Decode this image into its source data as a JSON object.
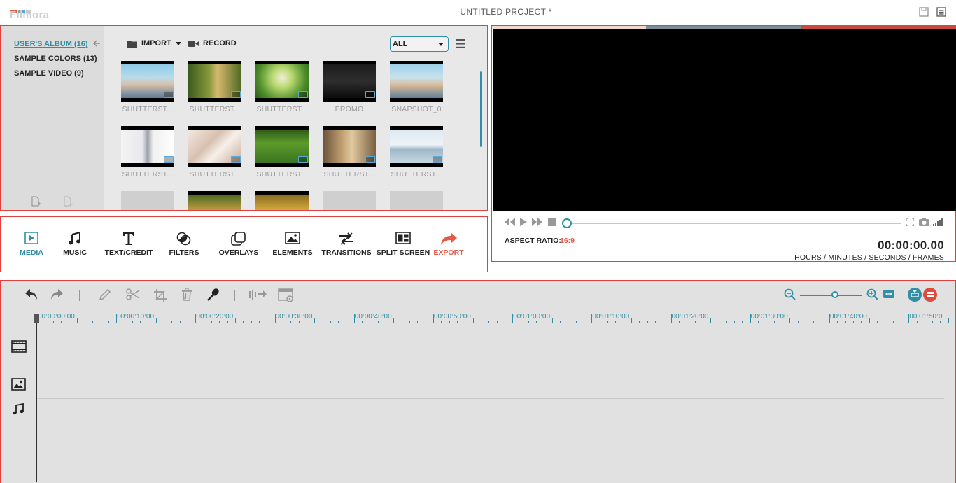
{
  "app": {
    "logo_text": "Filmora",
    "project_title": "UNTITLED PROJECT *"
  },
  "colors": {
    "accent": "#2f8fa6",
    "export": "#e35a46",
    "panel_border": "#e04040"
  },
  "library": {
    "albums": [
      {
        "label": "USER'S ALBUM (16)",
        "active": true
      },
      {
        "label": "SAMPLE COLORS (13)",
        "active": false
      },
      {
        "label": "SAMPLE VIDEO (9)",
        "active": false
      }
    ],
    "import_label": "IMPORT",
    "record_label": "RECORD",
    "filter_value": "ALL",
    "items": [
      {
        "label": "SHUTTERST..."
      },
      {
        "label": "SHUTTERST..."
      },
      {
        "label": "SHUTTERST..."
      },
      {
        "label": "PROMO"
      },
      {
        "label": "SNAPSHOT_0"
      },
      {
        "label": "SHUTTERST..."
      },
      {
        "label": "SHUTTERST..."
      },
      {
        "label": "SHUTTERST..."
      },
      {
        "label": "SHUTTERST..."
      },
      {
        "label": "SHUTTERST..."
      }
    ]
  },
  "tools": [
    {
      "label": "MEDIA",
      "icon": "media-icon"
    },
    {
      "label": "MUSIC",
      "icon": "music-icon"
    },
    {
      "label": "TEXT/CREDIT",
      "icon": "text-icon"
    },
    {
      "label": "FILTERS",
      "icon": "filters-icon"
    },
    {
      "label": "OVERLAYS",
      "icon": "overlays-icon"
    },
    {
      "label": "ELEMENTS",
      "icon": "elements-icon"
    },
    {
      "label": "TRANSITIONS",
      "icon": "transitions-icon"
    },
    {
      "label": "SPLIT SCREEN",
      "icon": "split-screen-icon"
    },
    {
      "label": "EXPORT",
      "icon": "export-icon"
    }
  ],
  "preview": {
    "aspect_label": "ASPECT RATIO:",
    "aspect_value": "16:9",
    "timecode": "00:00:00.00",
    "timecode_units": "HOURS / MINUTES / SECONDS / FRAMES",
    "progress": 0
  },
  "timeline": {
    "ruler": [
      "00:00:00:00",
      "00:00:10:00",
      "00:00:20:00",
      "00:00:30:00",
      "00:00:40:00",
      "00:00:50:00",
      "00:01:00:00",
      "00:01:10:00",
      "00:01:20:00",
      "00:01:30:00",
      "00:01:40:00",
      "00:01:50:0"
    ],
    "zoom_level": 0.5
  }
}
